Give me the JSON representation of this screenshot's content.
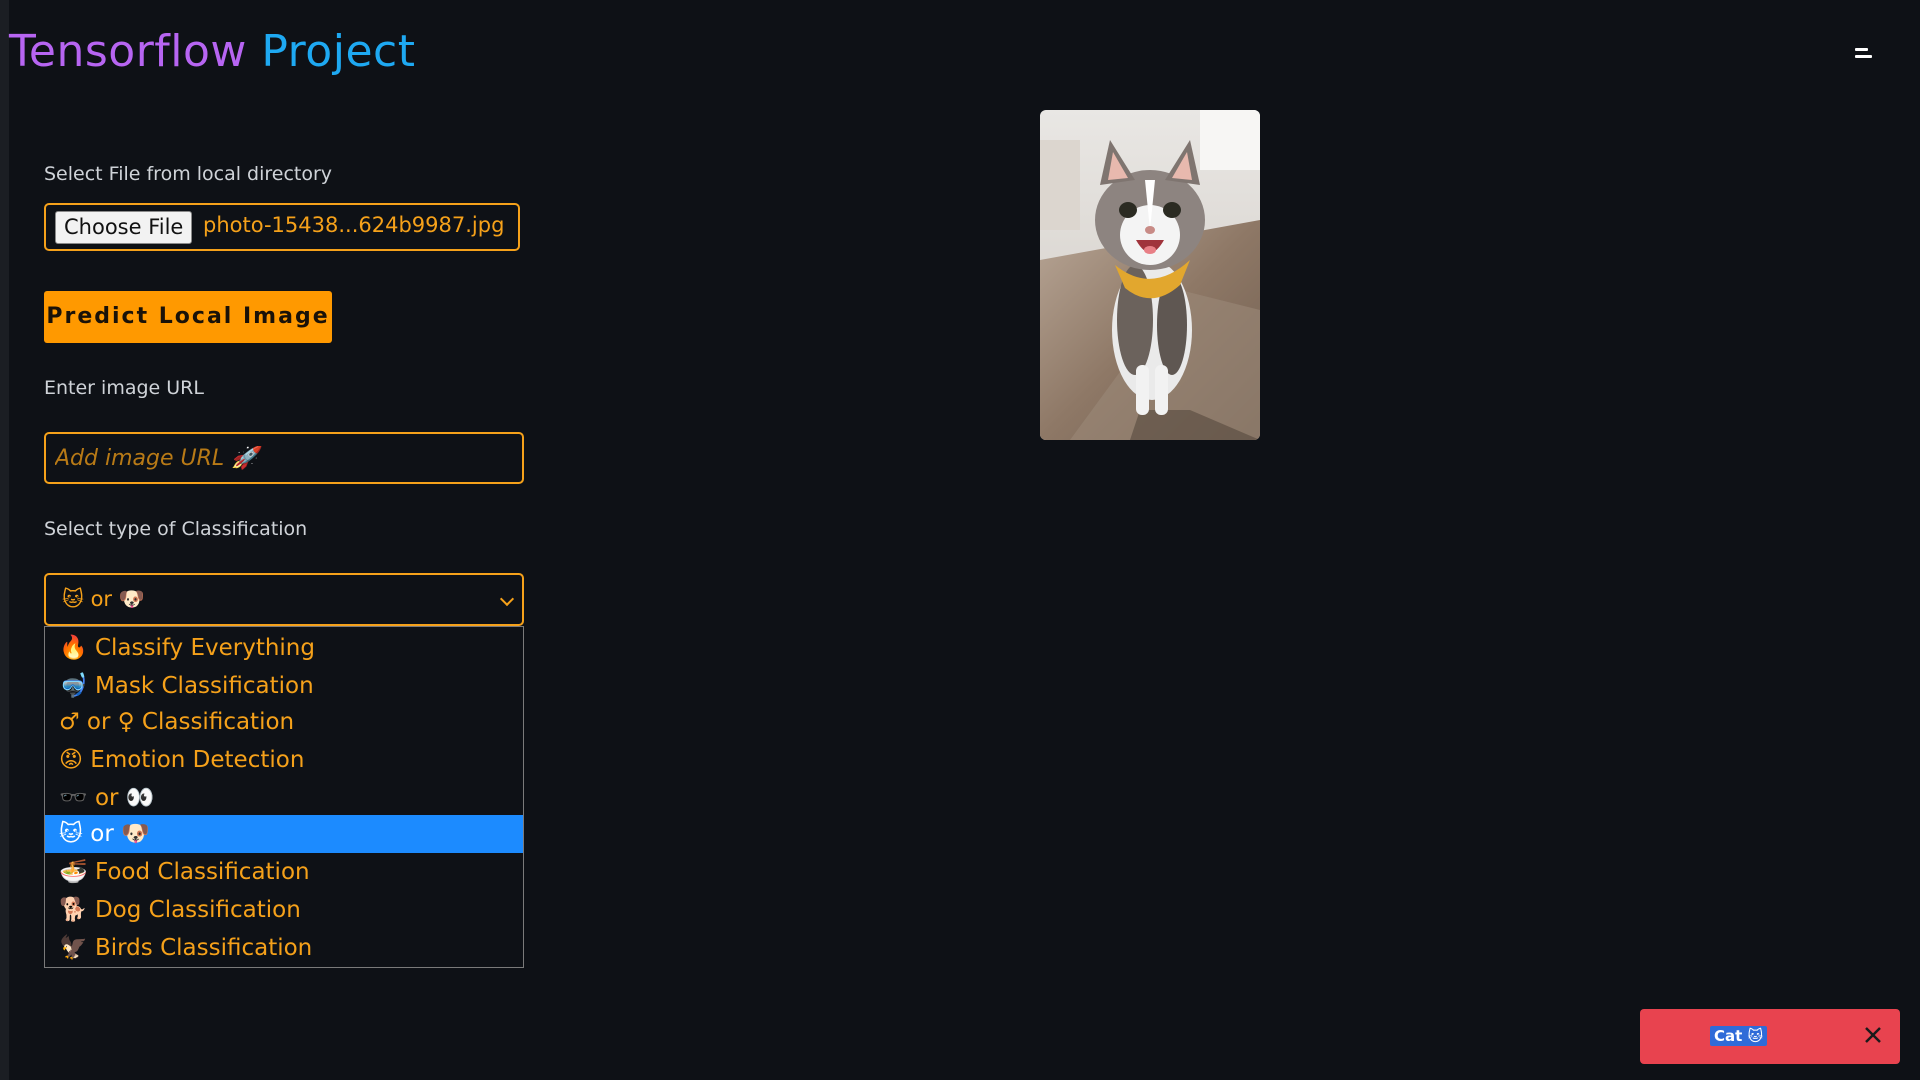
{
  "header": {
    "title_part1": "Tensorflow",
    "title_part2": "Project",
    "menu_icon": "hamburger-menu-icon"
  },
  "file_section": {
    "label": "Select File from local directory",
    "choose_button": "Choose File",
    "file_name": "photo-15438...624b9987.jpg"
  },
  "predict_button": "Predict Local Image",
  "url_section": {
    "label": "Enter image URL",
    "placeholder": "Add image URL 🚀"
  },
  "classification": {
    "label": "Select type of Classification",
    "selected_value": "🐱 or 🐶",
    "options": [
      {
        "label": "🔥 Classify Everything",
        "selected": false
      },
      {
        "label": "🤿 Mask Classification",
        "selected": false
      },
      {
        "label": "♂ or ♀ Classification",
        "selected": false
      },
      {
        "label": "😡 Emotion Detection",
        "selected": false
      },
      {
        "label": "🕶️ or 👀",
        "selected": false
      },
      {
        "label": "🐱 or 🐶",
        "selected": true
      },
      {
        "label": "🍜 Food Classification",
        "selected": false
      },
      {
        "label": "🐕 Dog Classification",
        "selected": false
      },
      {
        "label": "🦅 Birds Classification",
        "selected": false
      }
    ]
  },
  "preview_image": {
    "subject": "cat photo"
  },
  "toast": {
    "text": "Cat 🐱",
    "close_icon": "close-icon",
    "color": "#e8434f"
  },
  "colors": {
    "accent": "#f5a11a",
    "button": "#ff9900",
    "title_purple": "#b765f2",
    "title_blue": "#1ea9f2",
    "background": "#0e1116",
    "selected_option": "#1c8bff"
  }
}
